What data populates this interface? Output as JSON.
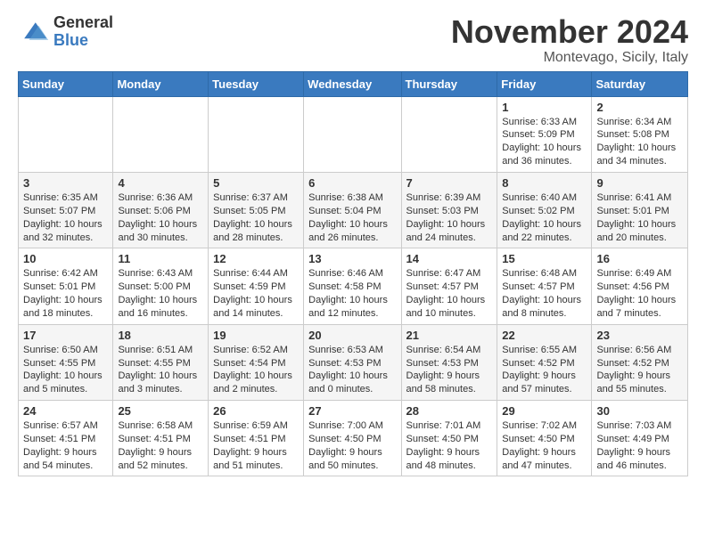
{
  "logo": {
    "general": "General",
    "blue": "Blue"
  },
  "title": "November 2024",
  "location": "Montevago, Sicily, Italy",
  "headers": [
    "Sunday",
    "Monday",
    "Tuesday",
    "Wednesday",
    "Thursday",
    "Friday",
    "Saturday"
  ],
  "weeks": [
    [
      {
        "day": "",
        "lines": []
      },
      {
        "day": "",
        "lines": []
      },
      {
        "day": "",
        "lines": []
      },
      {
        "day": "",
        "lines": []
      },
      {
        "day": "",
        "lines": []
      },
      {
        "day": "1",
        "lines": [
          "Sunrise: 6:33 AM",
          "Sunset: 5:09 PM",
          "Daylight: 10 hours",
          "and 36 minutes."
        ]
      },
      {
        "day": "2",
        "lines": [
          "Sunrise: 6:34 AM",
          "Sunset: 5:08 PM",
          "Daylight: 10 hours",
          "and 34 minutes."
        ]
      }
    ],
    [
      {
        "day": "3",
        "lines": [
          "Sunrise: 6:35 AM",
          "Sunset: 5:07 PM",
          "Daylight: 10 hours",
          "and 32 minutes."
        ]
      },
      {
        "day": "4",
        "lines": [
          "Sunrise: 6:36 AM",
          "Sunset: 5:06 PM",
          "Daylight: 10 hours",
          "and 30 minutes."
        ]
      },
      {
        "day": "5",
        "lines": [
          "Sunrise: 6:37 AM",
          "Sunset: 5:05 PM",
          "Daylight: 10 hours",
          "and 28 minutes."
        ]
      },
      {
        "day": "6",
        "lines": [
          "Sunrise: 6:38 AM",
          "Sunset: 5:04 PM",
          "Daylight: 10 hours",
          "and 26 minutes."
        ]
      },
      {
        "day": "7",
        "lines": [
          "Sunrise: 6:39 AM",
          "Sunset: 5:03 PM",
          "Daylight: 10 hours",
          "and 24 minutes."
        ]
      },
      {
        "day": "8",
        "lines": [
          "Sunrise: 6:40 AM",
          "Sunset: 5:02 PM",
          "Daylight: 10 hours",
          "and 22 minutes."
        ]
      },
      {
        "day": "9",
        "lines": [
          "Sunrise: 6:41 AM",
          "Sunset: 5:01 PM",
          "Daylight: 10 hours",
          "and 20 minutes."
        ]
      }
    ],
    [
      {
        "day": "10",
        "lines": [
          "Sunrise: 6:42 AM",
          "Sunset: 5:01 PM",
          "Daylight: 10 hours",
          "and 18 minutes."
        ]
      },
      {
        "day": "11",
        "lines": [
          "Sunrise: 6:43 AM",
          "Sunset: 5:00 PM",
          "Daylight: 10 hours",
          "and 16 minutes."
        ]
      },
      {
        "day": "12",
        "lines": [
          "Sunrise: 6:44 AM",
          "Sunset: 4:59 PM",
          "Daylight: 10 hours",
          "and 14 minutes."
        ]
      },
      {
        "day": "13",
        "lines": [
          "Sunrise: 6:46 AM",
          "Sunset: 4:58 PM",
          "Daylight: 10 hours",
          "and 12 minutes."
        ]
      },
      {
        "day": "14",
        "lines": [
          "Sunrise: 6:47 AM",
          "Sunset: 4:57 PM",
          "Daylight: 10 hours",
          "and 10 minutes."
        ]
      },
      {
        "day": "15",
        "lines": [
          "Sunrise: 6:48 AM",
          "Sunset: 4:57 PM",
          "Daylight: 10 hours",
          "and 8 minutes."
        ]
      },
      {
        "day": "16",
        "lines": [
          "Sunrise: 6:49 AM",
          "Sunset: 4:56 PM",
          "Daylight: 10 hours",
          "and 7 minutes."
        ]
      }
    ],
    [
      {
        "day": "17",
        "lines": [
          "Sunrise: 6:50 AM",
          "Sunset: 4:55 PM",
          "Daylight: 10 hours",
          "and 5 minutes."
        ]
      },
      {
        "day": "18",
        "lines": [
          "Sunrise: 6:51 AM",
          "Sunset: 4:55 PM",
          "Daylight: 10 hours",
          "and 3 minutes."
        ]
      },
      {
        "day": "19",
        "lines": [
          "Sunrise: 6:52 AM",
          "Sunset: 4:54 PM",
          "Daylight: 10 hours",
          "and 2 minutes."
        ]
      },
      {
        "day": "20",
        "lines": [
          "Sunrise: 6:53 AM",
          "Sunset: 4:53 PM",
          "Daylight: 10 hours",
          "and 0 minutes."
        ]
      },
      {
        "day": "21",
        "lines": [
          "Sunrise: 6:54 AM",
          "Sunset: 4:53 PM",
          "Daylight: 9 hours",
          "and 58 minutes."
        ]
      },
      {
        "day": "22",
        "lines": [
          "Sunrise: 6:55 AM",
          "Sunset: 4:52 PM",
          "Daylight: 9 hours",
          "and 57 minutes."
        ]
      },
      {
        "day": "23",
        "lines": [
          "Sunrise: 6:56 AM",
          "Sunset: 4:52 PM",
          "Daylight: 9 hours",
          "and 55 minutes."
        ]
      }
    ],
    [
      {
        "day": "24",
        "lines": [
          "Sunrise: 6:57 AM",
          "Sunset: 4:51 PM",
          "Daylight: 9 hours",
          "and 54 minutes."
        ]
      },
      {
        "day": "25",
        "lines": [
          "Sunrise: 6:58 AM",
          "Sunset: 4:51 PM",
          "Daylight: 9 hours",
          "and 52 minutes."
        ]
      },
      {
        "day": "26",
        "lines": [
          "Sunrise: 6:59 AM",
          "Sunset: 4:51 PM",
          "Daylight: 9 hours",
          "and 51 minutes."
        ]
      },
      {
        "day": "27",
        "lines": [
          "Sunrise: 7:00 AM",
          "Sunset: 4:50 PM",
          "Daylight: 9 hours",
          "and 50 minutes."
        ]
      },
      {
        "day": "28",
        "lines": [
          "Sunrise: 7:01 AM",
          "Sunset: 4:50 PM",
          "Daylight: 9 hours",
          "and 48 minutes."
        ]
      },
      {
        "day": "29",
        "lines": [
          "Sunrise: 7:02 AM",
          "Sunset: 4:50 PM",
          "Daylight: 9 hours",
          "and 47 minutes."
        ]
      },
      {
        "day": "30",
        "lines": [
          "Sunrise: 7:03 AM",
          "Sunset: 4:49 PM",
          "Daylight: 9 hours",
          "and 46 minutes."
        ]
      }
    ]
  ]
}
